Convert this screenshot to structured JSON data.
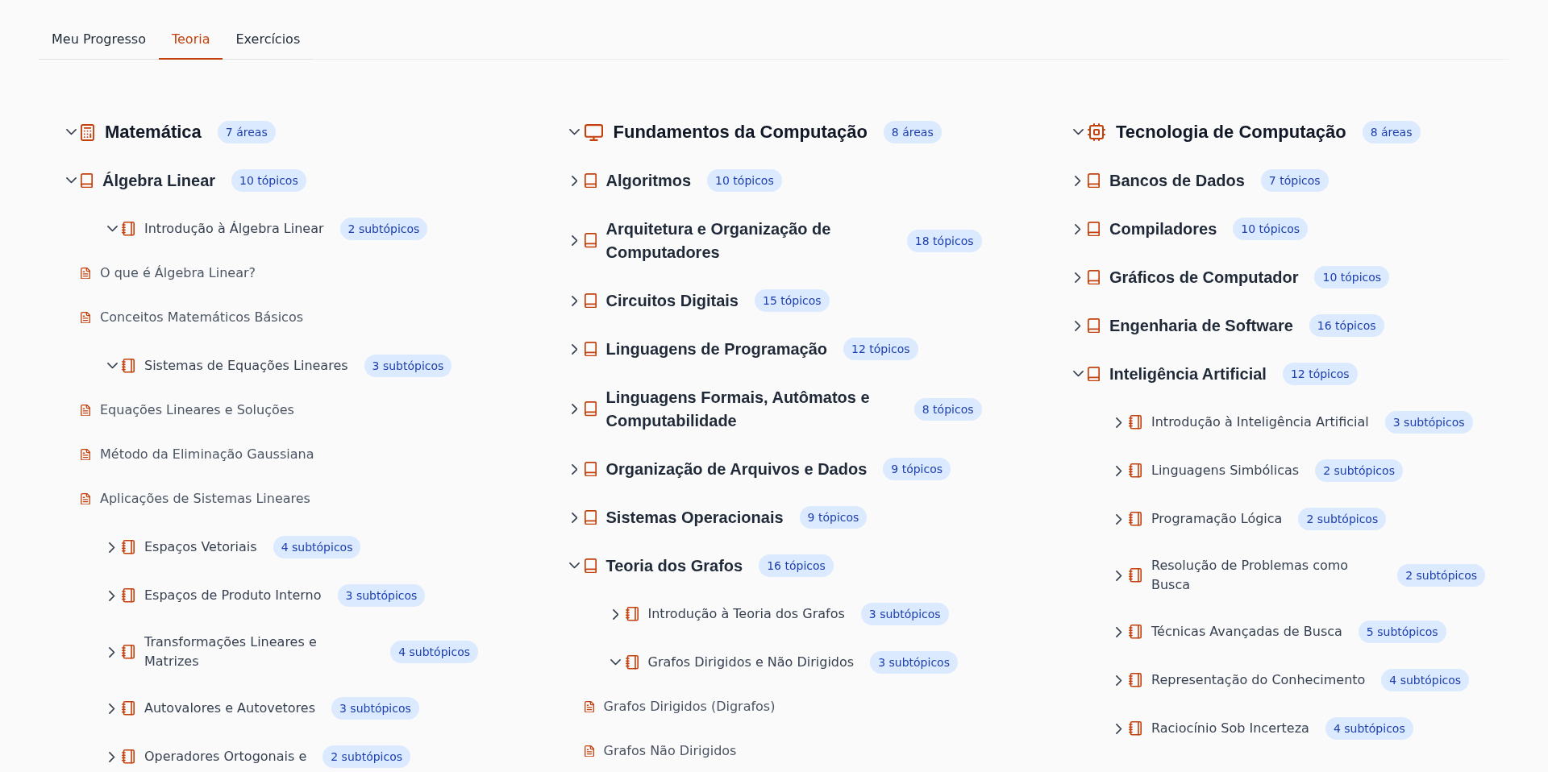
{
  "tabs": [
    {
      "label": "Meu Progresso",
      "selected": false
    },
    {
      "label": "Teoria",
      "selected": true
    },
    {
      "label": "Exercícios",
      "selected": false
    }
  ],
  "subjects": [
    {
      "title": "Matemática",
      "count": "7 áreas",
      "expanded": true,
      "children": [
        {
          "title": "Álgebra Linear",
          "count": "10 tópicos",
          "expanded": true,
          "children": [
            {
              "title": "Introdução à Álgebra Linear",
              "count": "2 subtópicos",
              "expanded": true,
              "children": [
                {
                  "title": "O que é Álgebra Linear?"
                },
                {
                  "title": "Conceitos Matemáticos Básicos"
                }
              ]
            },
            {
              "title": "Sistemas de Equações Lineares",
              "count": "3 subtópicos",
              "expanded": true,
              "children": [
                {
                  "title": "Equações Lineares e Soluções"
                },
                {
                  "title": "Método da Eliminação Gaussiana"
                },
                {
                  "title": "Aplicações de Sistemas Lineares"
                }
              ]
            },
            {
              "title": "Espaços Vetoriais",
              "count": "4 subtópicos",
              "expanded": false
            },
            {
              "title": "Espaços de Produto Interno",
              "count": "3 subtópicos",
              "expanded": false
            },
            {
              "title": "Transformações Lineares e Matrizes",
              "count": "4 subtópicos",
              "expanded": false
            },
            {
              "title": "Autovalores e Autovetores",
              "count": "3 subtópicos",
              "expanded": false
            },
            {
              "title": "Operadores Ortogonais e",
              "count": "2 subtópicos",
              "expanded": false
            }
          ]
        }
      ]
    },
    {
      "title": "Fundamentos da Computação",
      "count": "8 áreas",
      "expanded": true,
      "children": [
        {
          "title": "Algoritmos",
          "count": "10 tópicos",
          "expanded": false
        },
        {
          "title": "Arquitetura e Organização de Computadores",
          "count": "18 tópicos",
          "expanded": false
        },
        {
          "title": "Circuitos Digitais",
          "count": "15 tópicos",
          "expanded": false
        },
        {
          "title": "Linguagens de Programação",
          "count": "12 tópicos",
          "expanded": false
        },
        {
          "title": "Linguagens Formais, Autômatos e Computabilidade",
          "count": "8 tópicos",
          "expanded": false
        },
        {
          "title": "Organização de Arquivos e Dados",
          "count": "9 tópicos",
          "expanded": false
        },
        {
          "title": "Sistemas Operacionais",
          "count": "9 tópicos",
          "expanded": false
        },
        {
          "title": "Teoria dos Grafos",
          "count": "16 tópicos",
          "expanded": true,
          "children": [
            {
              "title": "Introdução à Teoria dos Grafos",
              "count": "3 subtópicos",
              "expanded": false
            },
            {
              "title": "Grafos Dirigidos e Não Dirigidos",
              "count": "3 subtópicos",
              "expanded": true,
              "children": [
                {
                  "title": "Grafos Dirigidos (Digrafos)"
                },
                {
                  "title": "Grafos Não Dirigidos"
                }
              ]
            }
          ]
        }
      ]
    },
    {
      "title": "Tecnologia de Computação",
      "count": "8 áreas",
      "expanded": true,
      "children": [
        {
          "title": "Bancos de Dados",
          "count": "7 tópicos",
          "expanded": false
        },
        {
          "title": "Compiladores",
          "count": "10 tópicos",
          "expanded": false
        },
        {
          "title": "Gráficos de Computador",
          "count": "10 tópicos",
          "expanded": false
        },
        {
          "title": "Engenharia de Software",
          "count": "16 tópicos",
          "expanded": false
        },
        {
          "title": "Inteligência Artificial",
          "count": "12 tópicos",
          "expanded": true,
          "children": [
            {
              "title": "Introdução à Inteligência Artificial",
              "count": "3 subtópicos",
              "expanded": false
            },
            {
              "title": "Linguagens Simbólicas",
              "count": "2 subtópicos",
              "expanded": false
            },
            {
              "title": "Programação Lógica",
              "count": "2 subtópicos",
              "expanded": false
            },
            {
              "title": "Resolução de Problemas como Busca",
              "count": "2 subtópicos",
              "expanded": false
            },
            {
              "title": "Técnicas Avançadas de Busca",
              "count": "5 subtópicos",
              "expanded": false
            },
            {
              "title": "Representação do Conhecimento",
              "count": "4 subtópicos",
              "expanded": false
            },
            {
              "title": "Raciocínio Sob Incerteza",
              "count": "4 subtópicos",
              "expanded": false
            }
          ]
        }
      ]
    }
  ]
}
